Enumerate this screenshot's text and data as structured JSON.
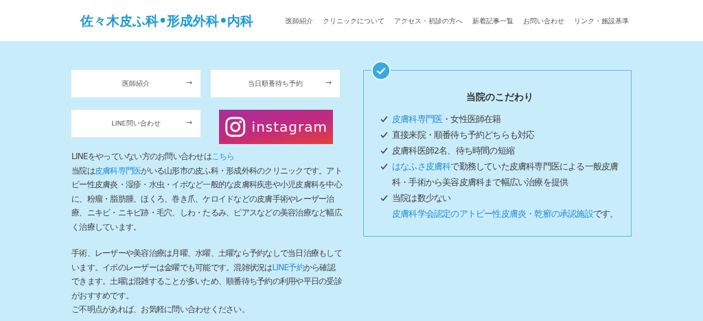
{
  "header": {
    "logo": "佐々木皮ふ科•形成外科•内科",
    "nav": [
      "医師紹介",
      "クリニックについて",
      "アクセス・初診の方へ",
      "新着記事一覧",
      "お問い合わせ",
      "リンク・施設基準"
    ]
  },
  "buttons": [
    {
      "kind": "arrow",
      "label": "医師紹介",
      "arrow": "→"
    },
    {
      "kind": "arrow",
      "label": "当日順番待ち予約",
      "arrow": "→"
    },
    {
      "kind": "arrow",
      "label": "LINE問い合わせ",
      "arrow": "→"
    },
    {
      "kind": "instagram",
      "label": "instagram"
    }
  ],
  "paragraphs": [
    [
      {
        "text": "LINEをやっていない方のお問い合わせは",
        "link": false
      },
      {
        "text": "こちら",
        "link": true
      }
    ],
    [
      {
        "text": "当院は",
        "link": false
      },
      {
        "text": "皮膚科専門医",
        "link": true
      },
      {
        "text": "がいる山形市の皮ふ科・形成外科のクリニックです。アトピー性皮膚炎・湿疹・水虫・イボなど一般的な皮膚科疾患や小児皮膚科を中心に、粉瘤・脂肪腫、ほくろ、巻き爪、ケロイドなどの皮膚手術やレーザー治療、ニキビ・ニキビ跡・毛穴、しわ・たるみ、ピアスなどの美容治療など幅広く治療しています。",
        "link": false
      }
    ],
    [
      {
        "text": "手術、レーザーや美容治療は月曜、水曜、土曜なら予約なしで当日治療もしています。イボのレーザーは金曜でも可能です。混雑状況は",
        "link": false
      },
      {
        "text": "LINE予約",
        "link": true
      },
      {
        "text": "から確認できます。土曜は混雑することが多いため、順番待ち予約の利用や平日の受診がおすすめです。",
        "link": false
      }
    ],
    [
      {
        "text": "ご不明点があれば、お気軽に問い合わせください。",
        "link": false
      }
    ]
  ],
  "features": {
    "title": "当院のこだわり",
    "items": [
      [
        {
          "text": "皮膚科専門医",
          "link": true
        },
        {
          "text": "・女性医師在籍",
          "link": false
        }
      ],
      [
        {
          "text": "直接来院・順番待ち予約どちらも対応",
          "link": false
        }
      ],
      [
        {
          "text": "皮膚科医師2名、待ち時間の短縮",
          "link": false
        }
      ],
      [
        {
          "text": "はなふさ皮膚科",
          "link": true
        },
        {
          "text": "で勤務していた皮膚科専門医による一般皮膚科・手術から美容皮膚科まで幅広い治療を提供",
          "link": false
        }
      ],
      [
        {
          "text": "当院は数少ない",
          "link": false
        },
        {
          "text": "皮膚科学会認定のアトピー性皮膚炎・乾癬の承認施設",
          "link": true
        },
        {
          "text": "です。",
          "link": false
        }
      ]
    ]
  }
}
